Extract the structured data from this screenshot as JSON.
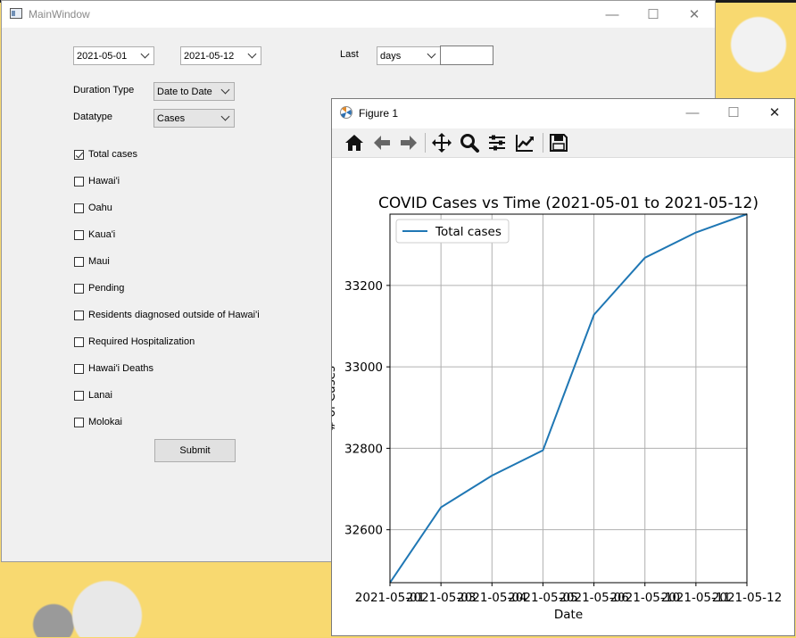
{
  "main_window": {
    "title": "MainWindow",
    "start_date": "2021-05-01",
    "end_date": "2021-05-12",
    "last_label": "Last",
    "last_unit": "days",
    "last_value": "",
    "duration_type_label": "Duration Type",
    "duration_type_value": "Date to Date",
    "datatype_label": "Datatype",
    "datatype_value": "Cases",
    "checkboxes": [
      {
        "label": "Total cases",
        "checked": true
      },
      {
        "label": "Hawai'i",
        "checked": false
      },
      {
        "label": "Oahu",
        "checked": false
      },
      {
        "label": "Kaua'i",
        "checked": false
      },
      {
        "label": "Maui",
        "checked": false
      },
      {
        "label": "Pending",
        "checked": false
      },
      {
        "label": "Residents diagnosed outside of Hawai'i",
        "checked": false
      },
      {
        "label": "Required Hospitalization",
        "checked": false
      },
      {
        "label": "Hawai'i Deaths",
        "checked": false
      },
      {
        "label": "Lanai",
        "checked": false
      },
      {
        "label": "Molokai",
        "checked": false
      }
    ],
    "submit_label": "Submit"
  },
  "figure_window": {
    "title": "Figure 1",
    "toolbar": [
      "home-icon",
      "back-icon",
      "forward-icon",
      "pan-icon",
      "zoom-icon",
      "subplots-icon",
      "edit-axes-icon",
      "save-icon"
    ]
  },
  "chart_data": {
    "type": "line",
    "title": "COVID Cases vs Time (2021-05-01 to 2021-05-12)",
    "xlabel": "Date",
    "ylabel": "# of Cases",
    "x": [
      "2021-05-01",
      "2021-05-03",
      "2021-05-04",
      "2021-05-05",
      "2021-05-06",
      "2021-05-07",
      "2021-05-11",
      "2021-05-12"
    ],
    "x_tick_labels": [
      "2021-05-01",
      "2021-05-03",
      "2021-05-04",
      "2021-05-05",
      "2021-05-06",
      "2021-05-10",
      "2021-05-11",
      "2021-05-12"
    ],
    "series": [
      {
        "name": "Total cases",
        "color": "#1f77b4",
        "values": [
          32470,
          32655,
          32733,
          32795,
          33128,
          33268,
          33330,
          33375
        ]
      }
    ],
    "yticks": [
      32600,
      32800,
      33000,
      33200
    ],
    "ylim": [
      32470,
      33375
    ],
    "grid": true,
    "legend": "upper-left"
  }
}
